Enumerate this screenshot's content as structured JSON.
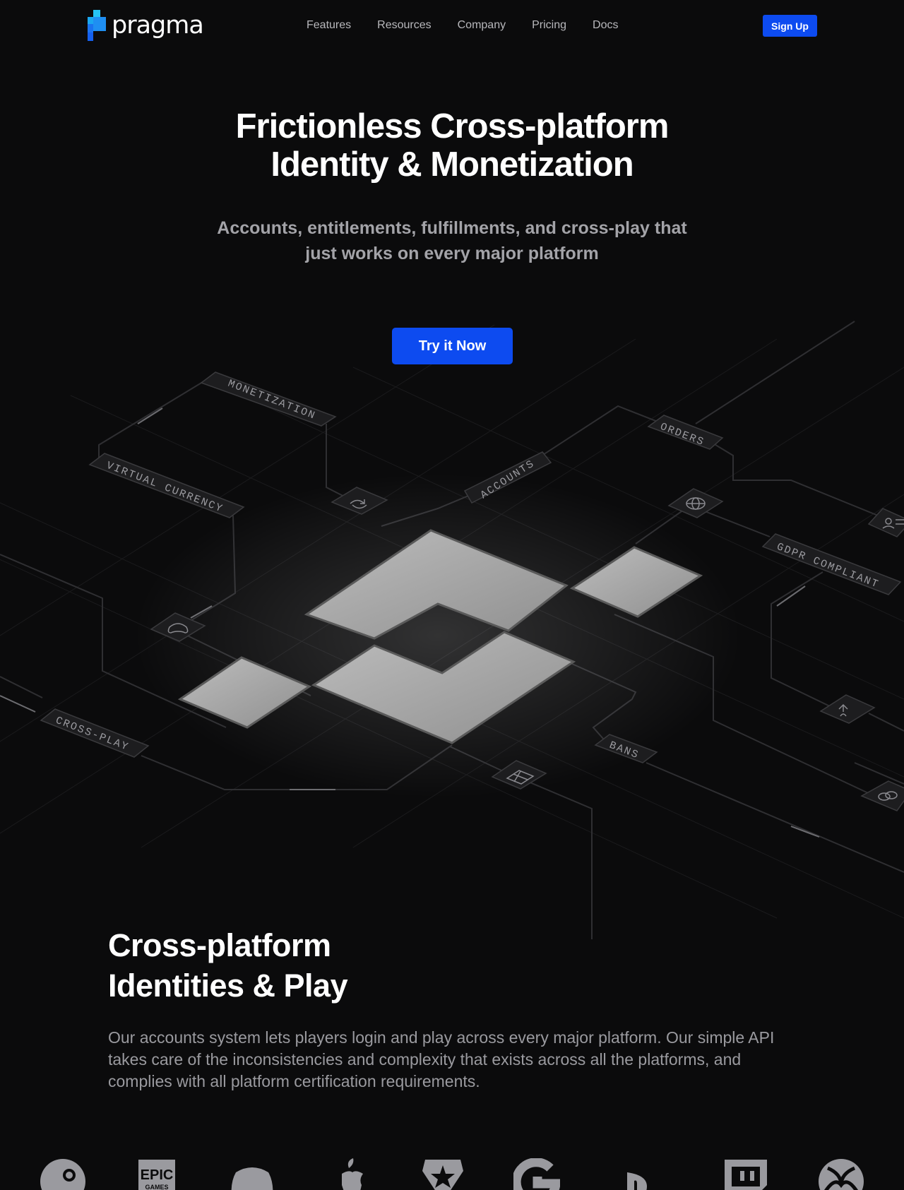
{
  "header": {
    "logo_text": "pragma",
    "nav": [
      "Features",
      "Resources",
      "Company",
      "Pricing",
      "Docs"
    ],
    "signup_label": "Sign Up"
  },
  "hero": {
    "title_line1": "Frictionless Cross-platform",
    "title_line2": "Identity & Monetization",
    "subtitle_line1": "Accounts, entitlements, fulfillments, and cross-play that",
    "subtitle_line2": "just works on every major platform",
    "cta_label": "Try it Now"
  },
  "diagram": {
    "labels": {
      "monetization": "MONETIZATION",
      "virtual_currency": "VIRTUAL CURRENCY",
      "accounts": "ACCOUNTS",
      "orders": "ORDERS",
      "gdpr": "GDPR COMPLIANT",
      "cross_play": "CROSS-PLAY",
      "bans": "BANS"
    },
    "icons": [
      "refresh-icon",
      "globe-icon",
      "user-list-icon",
      "gamepad-icon",
      "branch-icon",
      "table-icon",
      "link-icon"
    ]
  },
  "section_identity": {
    "title_line1": "Cross-platform",
    "title_line2": "Identities & Play",
    "body": "Our accounts system lets players login and play across every major platform. Our simple API takes care of the inconsistencies and complexity that exists across all the platforms, and complies with all platform certification requirements."
  },
  "platforms": [
    "steam-icon",
    "epic-games-icon",
    "discord-icon",
    "apple-icon",
    "star-badge-icon",
    "google-icon",
    "playstation-icon",
    "twitch-icon",
    "xbox-icon"
  ],
  "platform_text": {
    "epic": "EPIC",
    "games": "GAMES"
  },
  "colors": {
    "background": "#0b0b0c",
    "accent": "#0d4bf0",
    "logo_cyan": "#1fb8f0"
  }
}
